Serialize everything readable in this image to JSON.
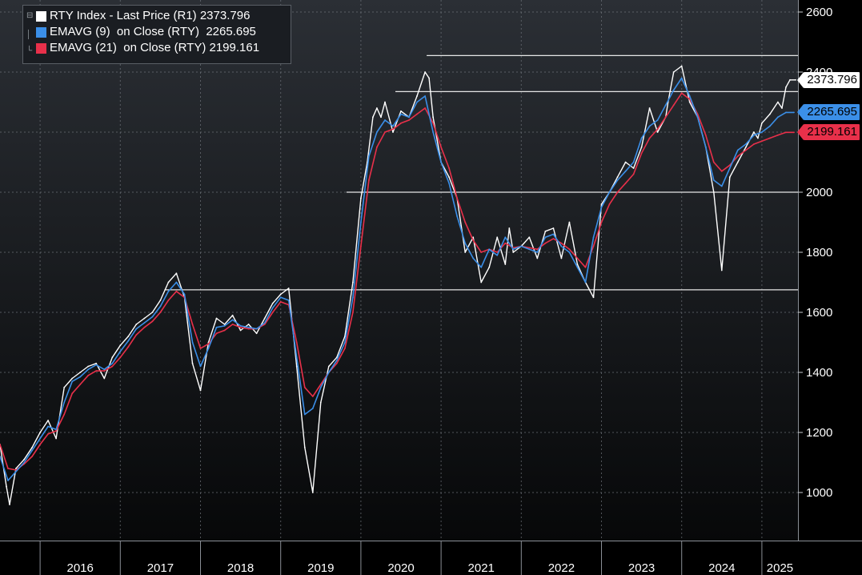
{
  "chart_data": {
    "type": "line",
    "legend": [
      {
        "label": "RTY Index - Last Price (R1) 2373.796",
        "color": "#ffffff"
      },
      {
        "label": "EMAVG (9)  on Close (RTY)  2265.695",
        "color": "#3b8fe8"
      },
      {
        "label": "EMAVG (21)  on Close (RTY) 2199.161",
        "color": "#e8304a"
      }
    ],
    "price_tags": [
      {
        "value": 2373.796,
        "label": "2373.796",
        "bg": "#ffffff",
        "fg": "#000000"
      },
      {
        "value": 2265.695,
        "label": "2265.695",
        "bg": "#3b8fe8",
        "fg": "#000000"
      },
      {
        "value": 2199.161,
        "label": "2199.161",
        "bg": "#e8304a",
        "fg": "#000000"
      }
    ],
    "y_ticks": [
      "1000",
      "1200",
      "1400",
      "1600",
      "1800",
      "2000",
      "2200",
      "2400",
      "2600"
    ],
    "ylim": [
      840,
      2640
    ],
    "x_ticks": [
      "2016",
      "2017",
      "2018",
      "2019",
      "2020",
      "2021",
      "2022",
      "2023",
      "2024",
      "2025"
    ],
    "xlim": [
      2015.5,
      2025.45
    ],
    "grid": true,
    "legend_position": "top-left",
    "horizontal_levels": [
      {
        "y": 2455,
        "x_start": 2020.82
      },
      {
        "y": 2335,
        "x_start": 2020.43
      },
      {
        "y": 2000,
        "x_start": 2019.82
      },
      {
        "y": 1675,
        "x_start": 2017.55
      }
    ],
    "series": [
      {
        "name": "RTY Index - Last Price",
        "color": "#ffffff",
        "x": [
          2015.5,
          2015.58,
          2015.62,
          2015.7,
          2015.8,
          2015.9,
          2016.0,
          2016.1,
          2016.2,
          2016.3,
          2016.4,
          2016.5,
          2016.6,
          2016.7,
          2016.8,
          2016.9,
          2017.0,
          2017.1,
          2017.2,
          2017.3,
          2017.4,
          2017.5,
          2017.6,
          2017.7,
          2017.8,
          2017.9,
          2018.0,
          2018.1,
          2018.2,
          2018.3,
          2018.4,
          2018.5,
          2018.6,
          2018.7,
          2018.8,
          2018.9,
          2019.0,
          2019.1,
          2019.2,
          2019.3,
          2019.4,
          2019.5,
          2019.6,
          2019.7,
          2019.8,
          2019.9,
          2020.0,
          2020.08,
          2020.15,
          2020.2,
          2020.25,
          2020.3,
          2020.4,
          2020.5,
          2020.6,
          2020.7,
          2020.8,
          2020.85,
          2020.9,
          2021.0,
          2021.1,
          2021.2,
          2021.3,
          2021.4,
          2021.5,
          2021.6,
          2021.7,
          2021.8,
          2021.85,
          2021.9,
          2022.0,
          2022.1,
          2022.2,
          2022.3,
          2022.4,
          2022.5,
          2022.6,
          2022.7,
          2022.8,
          2022.9,
          2023.0,
          2023.1,
          2023.2,
          2023.3,
          2023.4,
          2023.5,
          2023.6,
          2023.7,
          2023.8,
          2023.83,
          2023.9,
          2024.0,
          2024.1,
          2024.2,
          2024.3,
          2024.4,
          2024.5,
          2024.6,
          2024.7,
          2024.8,
          2024.9,
          2024.95,
          2025.0,
          2025.1,
          2025.2,
          2025.25,
          2025.3,
          2025.35,
          2025.42
        ],
        "y": [
          1160,
          1020,
          960,
          1080,
          1110,
          1150,
          1200,
          1240,
          1180,
          1350,
          1380,
          1400,
          1420,
          1430,
          1380,
          1450,
          1490,
          1520,
          1560,
          1580,
          1600,
          1640,
          1700,
          1730,
          1650,
          1430,
          1340,
          1500,
          1580,
          1560,
          1590,
          1540,
          1560,
          1530,
          1580,
          1630,
          1660,
          1680,
          1420,
          1150,
          1000,
          1300,
          1420,
          1450,
          1520,
          1700,
          1980,
          2100,
          2250,
          2280,
          2250,
          2300,
          2200,
          2270,
          2250,
          2320,
          2400,
          2380,
          2250,
          2100,
          2050,
          1980,
          1800,
          1850,
          1700,
          1750,
          1850,
          1760,
          1880,
          1800,
          1820,
          1850,
          1780,
          1870,
          1880,
          1780,
          1900,
          1760,
          1700,
          1650,
          1960,
          2000,
          2050,
          2100,
          2080,
          2150,
          2280,
          2200,
          2250,
          2300,
          2400,
          2420,
          2300,
          2250,
          2150,
          2000,
          1740,
          2050,
          2100,
          2150,
          2200,
          2180,
          2230,
          2260,
          2300,
          2280,
          2350,
          2373.796,
          2373.796
        ]
      },
      {
        "name": "EMAVG (9) on Close (RTY)",
        "color": "#3b8fe8",
        "x": [
          2015.5,
          2015.6,
          2015.7,
          2015.8,
          2015.9,
          2016.0,
          2016.1,
          2016.2,
          2016.3,
          2016.4,
          2016.5,
          2016.6,
          2016.7,
          2016.8,
          2016.9,
          2017.0,
          2017.1,
          2017.2,
          2017.3,
          2017.4,
          2017.5,
          2017.6,
          2017.7,
          2017.8,
          2017.9,
          2018.0,
          2018.1,
          2018.2,
          2018.3,
          2018.4,
          2018.5,
          2018.6,
          2018.7,
          2018.8,
          2018.9,
          2019.0,
          2019.1,
          2019.2,
          2019.3,
          2019.4,
          2019.5,
          2019.6,
          2019.7,
          2019.8,
          2019.9,
          2020.0,
          2020.1,
          2020.2,
          2020.3,
          2020.4,
          2020.5,
          2020.6,
          2020.7,
          2020.8,
          2020.9,
          2021.0,
          2021.1,
          2021.2,
          2021.3,
          2021.4,
          2021.5,
          2021.6,
          2021.7,
          2021.8,
          2021.9,
          2022.0,
          2022.1,
          2022.2,
          2022.3,
          2022.4,
          2022.5,
          2022.6,
          2022.7,
          2022.8,
          2022.9,
          2023.0,
          2023.1,
          2023.2,
          2023.3,
          2023.4,
          2023.5,
          2023.6,
          2023.7,
          2023.8,
          2023.9,
          2024.0,
          2024.1,
          2024.2,
          2024.3,
          2024.4,
          2024.5,
          2024.6,
          2024.7,
          2024.8,
          2024.9,
          2025.0,
          2025.1,
          2025.2,
          2025.3,
          2025.4
        ],
        "y": [
          1120,
          1040,
          1070,
          1100,
          1140,
          1180,
          1220,
          1210,
          1300,
          1370,
          1385,
          1410,
          1425,
          1410,
          1430,
          1470,
          1505,
          1545,
          1565,
          1585,
          1620,
          1670,
          1700,
          1660,
          1500,
          1420,
          1480,
          1550,
          1555,
          1575,
          1555,
          1550,
          1545,
          1565,
          1615,
          1650,
          1640,
          1450,
          1260,
          1280,
          1350,
          1400,
          1440,
          1500,
          1650,
          1900,
          2120,
          2200,
          2240,
          2220,
          2260,
          2250,
          2300,
          2320,
          2200,
          2100,
          2030,
          1920,
          1830,
          1780,
          1750,
          1810,
          1790,
          1850,
          1810,
          1820,
          1810,
          1800,
          1850,
          1860,
          1820,
          1800,
          1750,
          1700,
          1850,
          1950,
          2000,
          2040,
          2070,
          2100,
          2180,
          2220,
          2240,
          2290,
          2340,
          2380,
          2320,
          2250,
          2150,
          2040,
          2020,
          2080,
          2140,
          2160,
          2190,
          2200,
          2220,
          2250,
          2265.695,
          2265.695
        ]
      },
      {
        "name": "EMAVG (21) on Close (RTY)",
        "color": "#e8304a",
        "x": [
          2015.5,
          2015.6,
          2015.7,
          2015.8,
          2015.9,
          2016.0,
          2016.1,
          2016.2,
          2016.3,
          2016.4,
          2016.5,
          2016.6,
          2016.7,
          2016.8,
          2016.9,
          2017.0,
          2017.1,
          2017.2,
          2017.3,
          2017.4,
          2017.5,
          2017.6,
          2017.7,
          2017.8,
          2017.9,
          2018.0,
          2018.1,
          2018.2,
          2018.3,
          2018.4,
          2018.5,
          2018.6,
          2018.7,
          2018.8,
          2018.9,
          2019.0,
          2019.1,
          2019.2,
          2019.3,
          2019.4,
          2019.5,
          2019.6,
          2019.7,
          2019.8,
          2019.9,
          2020.0,
          2020.1,
          2020.2,
          2020.3,
          2020.4,
          2020.5,
          2020.6,
          2020.7,
          2020.8,
          2020.9,
          2021.0,
          2021.1,
          2021.2,
          2021.3,
          2021.4,
          2021.5,
          2021.6,
          2021.7,
          2021.8,
          2021.9,
          2022.0,
          2022.1,
          2022.2,
          2022.3,
          2022.4,
          2022.5,
          2022.6,
          2022.7,
          2022.8,
          2022.9,
          2023.0,
          2023.1,
          2023.2,
          2023.3,
          2023.4,
          2023.5,
          2023.6,
          2023.7,
          2023.8,
          2023.9,
          2024.0,
          2024.1,
          2024.2,
          2024.3,
          2024.4,
          2024.5,
          2024.6,
          2024.7,
          2024.8,
          2024.9,
          2025.0,
          2025.1,
          2025.2,
          2025.3,
          2025.4
        ],
        "y": [
          1160,
          1080,
          1075,
          1095,
          1120,
          1160,
          1195,
          1205,
          1260,
          1330,
          1360,
          1390,
          1405,
          1405,
          1420,
          1450,
          1485,
          1525,
          1550,
          1570,
          1600,
          1640,
          1670,
          1650,
          1560,
          1480,
          1495,
          1530,
          1540,
          1560,
          1550,
          1545,
          1545,
          1560,
          1600,
          1635,
          1625,
          1500,
          1350,
          1320,
          1360,
          1400,
          1430,
          1480,
          1600,
          1820,
          2040,
          2150,
          2200,
          2210,
          2230,
          2240,
          2260,
          2280,
          2230,
          2150,
          2080,
          1980,
          1900,
          1840,
          1800,
          1810,
          1800,
          1830,
          1815,
          1820,
          1815,
          1810,
          1830,
          1845,
          1830,
          1810,
          1780,
          1750,
          1820,
          1900,
          1960,
          2000,
          2030,
          2060,
          2130,
          2180,
          2210,
          2250,
          2290,
          2330,
          2310,
          2260,
          2190,
          2100,
          2070,
          2090,
          2120,
          2140,
          2160,
          2170,
          2180,
          2190,
          2199.161,
          2199.161
        ]
      }
    ]
  }
}
